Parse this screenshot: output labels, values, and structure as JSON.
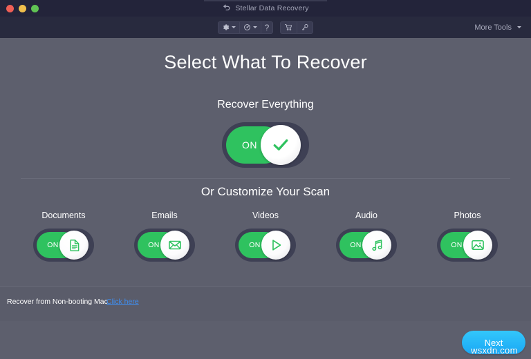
{
  "window": {
    "title": "Stellar Data Recovery",
    "title_icon": "back-arrow-icon",
    "traffic_lights": [
      {
        "name": "close",
        "color": "#ef5f56"
      },
      {
        "name": "minimize",
        "color": "#f0bf4c"
      },
      {
        "name": "maximize",
        "color": "#60c354"
      }
    ]
  },
  "toolbar": {
    "buttons": [
      {
        "name": "settings",
        "icon": "gear-icon",
        "has_caret": true
      },
      {
        "name": "recovery-history",
        "icon": "disc-icon",
        "has_caret": true
      },
      {
        "name": "help",
        "icon": "question-mark-icon",
        "has_caret": false
      },
      {
        "name": "buy",
        "icon": "cart-icon",
        "has_caret": false
      },
      {
        "name": "activate",
        "icon": "key-icon",
        "has_caret": false
      }
    ],
    "more_tools_label": "More Tools",
    "more_tools_icon": "chevron-down-icon"
  },
  "main": {
    "heading": "Select What To Recover",
    "everything": {
      "label": "Recover Everything",
      "toggle_state": "ON",
      "on_text": "ON",
      "knob_icon": "check-icon"
    },
    "customize_label": "Or Customize Your Scan",
    "categories": [
      {
        "label": "Documents",
        "on_text": "ON",
        "state": "ON",
        "icon": "document-icon"
      },
      {
        "label": "Emails",
        "on_text": "ON",
        "state": "ON",
        "icon": "envelope-icon"
      },
      {
        "label": "Videos",
        "on_text": "ON",
        "state": "ON",
        "icon": "play-icon"
      },
      {
        "label": "Audio",
        "on_text": "ON",
        "state": "ON",
        "icon": "music-note-icon"
      },
      {
        "label": "Photos",
        "on_text": "ON",
        "state": "ON",
        "icon": "photo-icon"
      }
    ]
  },
  "footer": {
    "text": "Recover from Non-booting Mac",
    "link_text": "Click here",
    "next_label": "Next"
  },
  "watermark": "wsxdn.com",
  "colors": {
    "titlebar_bg": "#23243a",
    "toolbar_bg": "#282a3e",
    "body_bg": "#5d5f6d",
    "toggle_track": "#3e4054",
    "accent_green": "#2fc25f",
    "link_blue": "#3f8ef0",
    "next_blue": "#1aa8f5"
  }
}
